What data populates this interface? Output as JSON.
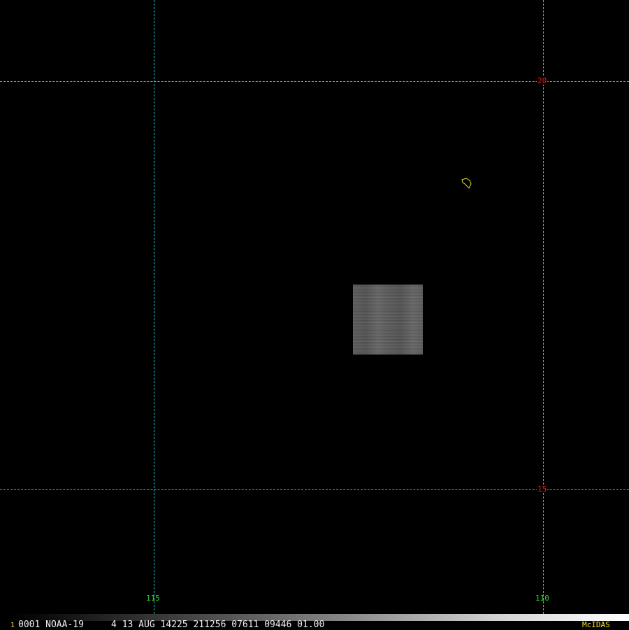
{
  "map": {
    "latitudes": [
      {
        "label": "20"
      },
      {
        "label": "15"
      }
    ],
    "longitudes": [
      {
        "label": "115"
      },
      {
        "label": "110"
      }
    ],
    "colors": {
      "background": "#000000",
      "grid": "#1fc8d0",
      "latitude_label": "#e02020",
      "longitude_label": "#30d030",
      "coastline": "#f0e020",
      "status_text": "#f0f0f0",
      "brand": "#f0e020"
    }
  },
  "status": {
    "frame": "1",
    "text": "0001 NOAA-19     4 13 AUG 14225 211256 07611 09446 01.00",
    "brand": "McIDAS"
  }
}
